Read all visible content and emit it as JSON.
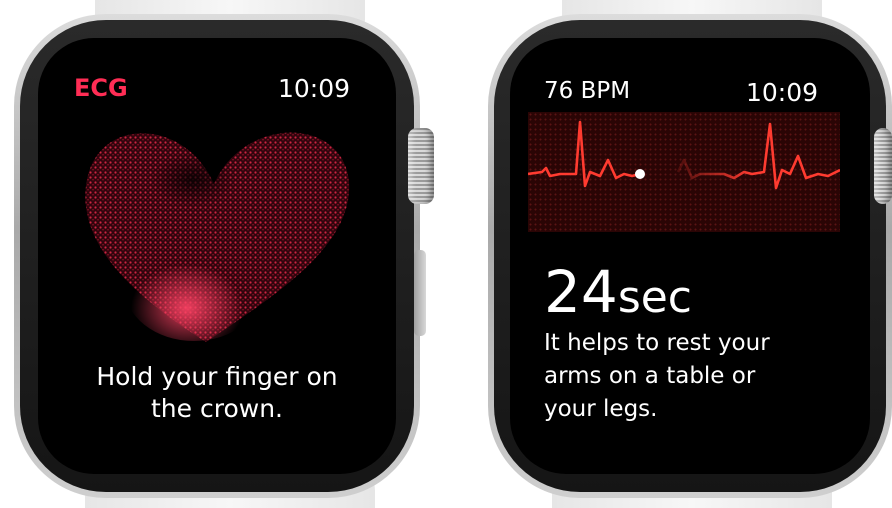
{
  "left_watch": {
    "app_title": "ECG",
    "time": "10:09",
    "instruction_line1": "Hold your finger on",
    "instruction_line2": "the crown.",
    "accent_color": "#ff2d55",
    "illustration": "heart-particles-icon"
  },
  "right_watch": {
    "heart_rate": "76 BPM",
    "time": "10:09",
    "countdown": "24",
    "countdown_unit": "sec",
    "tip_line1": "It helps to rest your",
    "tip_line2": "arms on a table or",
    "tip_line3": "your legs.",
    "waveform_color": "#ff3b30",
    "graph": "ecg-waveform-icon"
  }
}
